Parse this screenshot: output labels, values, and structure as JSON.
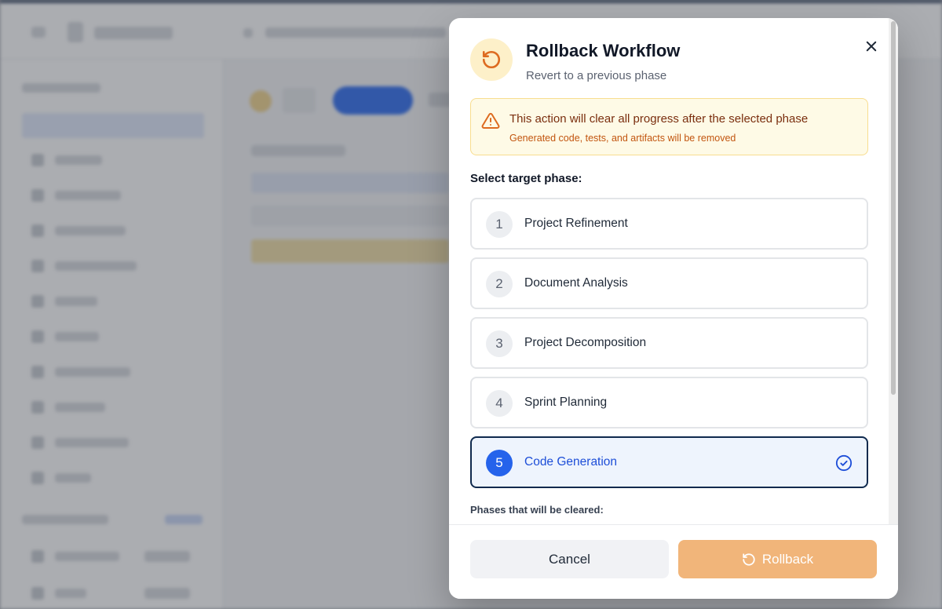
{
  "colors": {
    "accent_warning": "#c2550f",
    "selected_blue": "#2563eb",
    "rollback_button": "#f1b57a",
    "warning_bg": "#fefae6"
  },
  "modal": {
    "header_icon": "rotate-ccw-icon",
    "title": "Rollback Workflow",
    "subtitle": "Revert to a previous phase",
    "close_icon": "close-icon",
    "warning": {
      "icon": "alert-triangle-icon",
      "title": "This action will clear all progress after the selected phase",
      "subtitle": "Generated code, tests, and artifacts will be removed"
    },
    "select_label": "Select target phase:",
    "phases": [
      {
        "number": "1",
        "name": "Project Refinement",
        "selected": false
      },
      {
        "number": "2",
        "name": "Document Analysis",
        "selected": false
      },
      {
        "number": "3",
        "name": "Project Decomposition",
        "selected": false
      },
      {
        "number": "4",
        "name": "Sprint Planning",
        "selected": false
      },
      {
        "number": "5",
        "name": "Code Generation",
        "selected": true
      }
    ],
    "cleared_label": "Phases that will be cleared:",
    "footer": {
      "cancel_label": "Cancel",
      "rollback_label": "Rollback",
      "rollback_icon": "rotate-ccw-icon"
    }
  }
}
